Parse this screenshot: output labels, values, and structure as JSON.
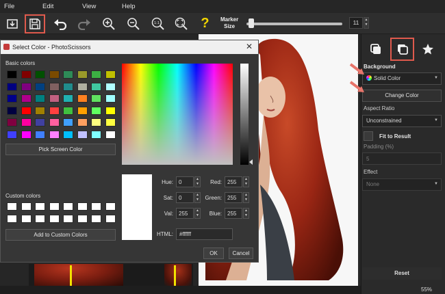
{
  "menu": [
    "File",
    "Edit",
    "View",
    "Help"
  ],
  "toolbar": {
    "marker_label_1": "Marker",
    "marker_label_2": "Size",
    "marker_size_value": "11",
    "marker_size_level": 0.05,
    "help_glyph": "?",
    "zoom_actual_glyph": "1:1",
    "icons": [
      "import-icon",
      "save-icon",
      "undo-icon",
      "redo-icon",
      "zoom-in-icon",
      "zoom-out-icon",
      "zoom-actual-icon",
      "zoom-fit-icon",
      "help-icon"
    ]
  },
  "panel": {
    "background_label": "Background",
    "background_mode": "Solid Color",
    "change_color_label": "Change Color",
    "aspect_ratio_label": "Aspect Ratio",
    "aspect_ratio_value": "Unconstrained",
    "fit_to_result_label": "Fit to Result",
    "padding_label": "Padding (%)",
    "padding_value": "5",
    "effect_label": "Effect",
    "effect_value": "None",
    "reset_label": "Reset",
    "zoom_value": "55%"
  },
  "dialog": {
    "title": "Select Color - PhotoScissors",
    "basic_colors_label": "Basic colors",
    "pick_screen_color_label": "Pick Screen Color",
    "custom_colors_label": "Custom colors",
    "add_custom_label": "Add to Custom Colors",
    "hue_label": "Hue:",
    "hue_value": "0",
    "sat_label": "Sat:",
    "sat_value": "0",
    "val_label": "Val:",
    "val_value": "255",
    "red_label": "Red:",
    "red_value": "255",
    "green_label": "Green:",
    "green_value": "255",
    "blue_label": "Blue:",
    "blue_value": "255",
    "html_label": "HTML:",
    "html_value": "#ffffff",
    "ok_label": "OK",
    "cancel_label": "Cancel",
    "basic_colors": [
      "#000000",
      "#800000",
      "#005000",
      "#7a4a00",
      "#2e8b57",
      "#9a9a2a",
      "#3cb043",
      "#c0c000",
      "#000080",
      "#800080",
      "#004080",
      "#806060",
      "#208c8c",
      "#b0b0a0",
      "#40c8a0",
      "#b0ffff",
      "#00008b",
      "#b0008b",
      "#008080",
      "#c06080",
      "#20b0b0",
      "#ff8020",
      "#60e060",
      "#a0ffff",
      "#000040",
      "#ff0000",
      "#a08000",
      "#ff4040",
      "#40c040",
      "#ffa000",
      "#60ff60",
      "#ffff00",
      "#800040",
      "#ff00a0",
      "#4040a0",
      "#ff60a0",
      "#40a0ff",
      "#ffa060",
      "#ffff80",
      "#ffff40",
      "#4040ff",
      "#ff00ff",
      "#4080ff",
      "#ff80ff",
      "#00c0ff",
      "#c0c0ff",
      "#80ffff",
      "#ffffff"
    ],
    "custom_colors": [
      "#ffffff",
      "#ffffff",
      "#ffffff",
      "#ffffff",
      "#ffffff",
      "#ffffff",
      "#ffffff",
      "#ffffff",
      "#ffffff",
      "#ffffff",
      "#ffffff",
      "#ffffff",
      "#ffffff",
      "#ffffff",
      "#ffffff",
      "#ffffff"
    ]
  },
  "colors": {
    "highlight": "#e05a4d",
    "accent_arrow": "#e8756b"
  }
}
